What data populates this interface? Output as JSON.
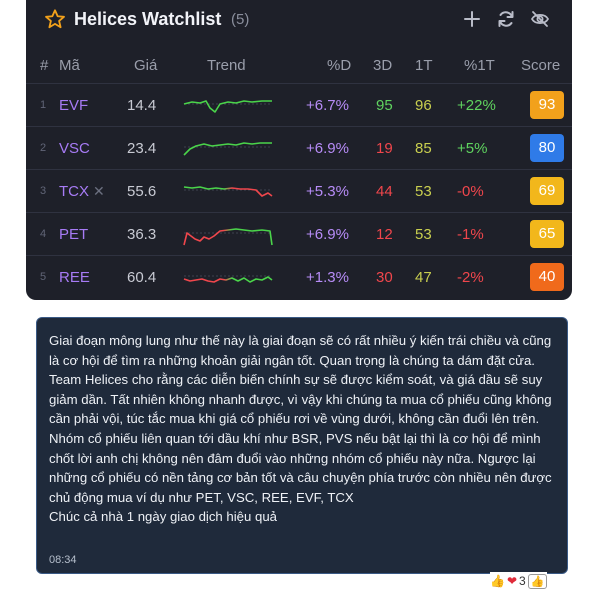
{
  "watchlist": {
    "title": "Helices Watchlist",
    "count": "(5)",
    "icons": {
      "star": "star-icon",
      "add": "plus-icon",
      "refresh": "refresh-icon",
      "hide": "eye-off-icon"
    },
    "columns": [
      "#",
      "Mã",
      "Giá",
      "Trend",
      "%D",
      "3D",
      "1T",
      "%1T",
      "Score"
    ],
    "rows": [
      {
        "rank": "1",
        "ticker": "EVF",
        "price": "14.4",
        "pct_d": "+6.7%",
        "d3": "95",
        "t1": "96",
        "pct_1t": "+22%",
        "score": "93",
        "d3_color": "#5fd35f",
        "pct_1t_color": "#5fd35f",
        "score_color": "#f2a11b",
        "trend_colors": [
          "#4ad44a"
        ]
      },
      {
        "rank": "2",
        "ticker": "VSC",
        "price": "23.4",
        "pct_d": "+6.9%",
        "d3": "19",
        "t1": "85",
        "pct_1t": "+5%",
        "score": "80",
        "d3_color": "#f0464c",
        "pct_1t_color": "#5fd35f",
        "score_color": "#2f7be8",
        "trend_colors": [
          "#4ad44a"
        ]
      },
      {
        "rank": "3",
        "ticker": "TCX",
        "price": "55.6",
        "pct_d": "+5.3%",
        "d3": "44",
        "t1": "53",
        "pct_1t": "-0%",
        "score": "69",
        "d3_color": "#f0464c",
        "pct_1t_color": "#f0464c",
        "score_color": "#f2b71b",
        "trend_colors": [
          "#4ad44a",
          "#f0464c"
        ]
      },
      {
        "rank": "4",
        "ticker": "PET",
        "price": "36.3",
        "pct_d": "+6.9%",
        "d3": "12",
        "t1": "53",
        "pct_1t": "-1%",
        "score": "65",
        "d3_color": "#f0464c",
        "pct_1t_color": "#f0464c",
        "score_color": "#f2b71b",
        "trend_colors": [
          "#f0464c",
          "#4ad44a"
        ]
      },
      {
        "rank": "5",
        "ticker": "REE",
        "price": "60.4",
        "pct_d": "+1.3%",
        "d3": "30",
        "t1": "47",
        "pct_1t": "-2%",
        "score": "40",
        "d3_color": "#f0464c",
        "pct_1t_color": "#f0464c",
        "score_color": "#f06a1b",
        "trend_colors": [
          "#f0464c",
          "#4ad44a"
        ]
      }
    ]
  },
  "message": {
    "text": "Giai đoạn mông lung như thế này là giai đoạn sẽ có rất nhiều ý kiến trái chiều và cũng là cơ hội để tìm ra những khoản giải ngân tốt. Quan trọng là chúng ta dám đặt cửa. Team Helices cho rằng các diễn biến chính sự sẽ được kiểm soát, và giá dầu sẽ suy giảm dần. Tất nhiên không nhanh được, vì vậy khi chúng ta mua cổ phiếu cũng không cần phải vội, túc tắc mua khi giá cổ phiếu rơi về vùng dưới, không cần đuổi lên trên.\nNhóm cổ phiếu liên quan tới dầu khí như BSR, PVS nếu bật lại thì là cơ hội để mình chốt lời anh chị không nên đâm đuổi vào những nhóm cổ phiếu này nữa. Ngược lại những cổ phiếu có nền tảng cơ bản tốt và câu chuyện phía trước còn nhiều nên được chủ động mua ví dụ như  PET, VSC, REE, EVF, TCX\nChúc cả nhà 1 ngày giao dịch hiệu quả",
    "time": "08:34",
    "reaction_count": "3",
    "reaction_icons": [
      "thumbs-up-icon",
      "heart-icon"
    ]
  }
}
